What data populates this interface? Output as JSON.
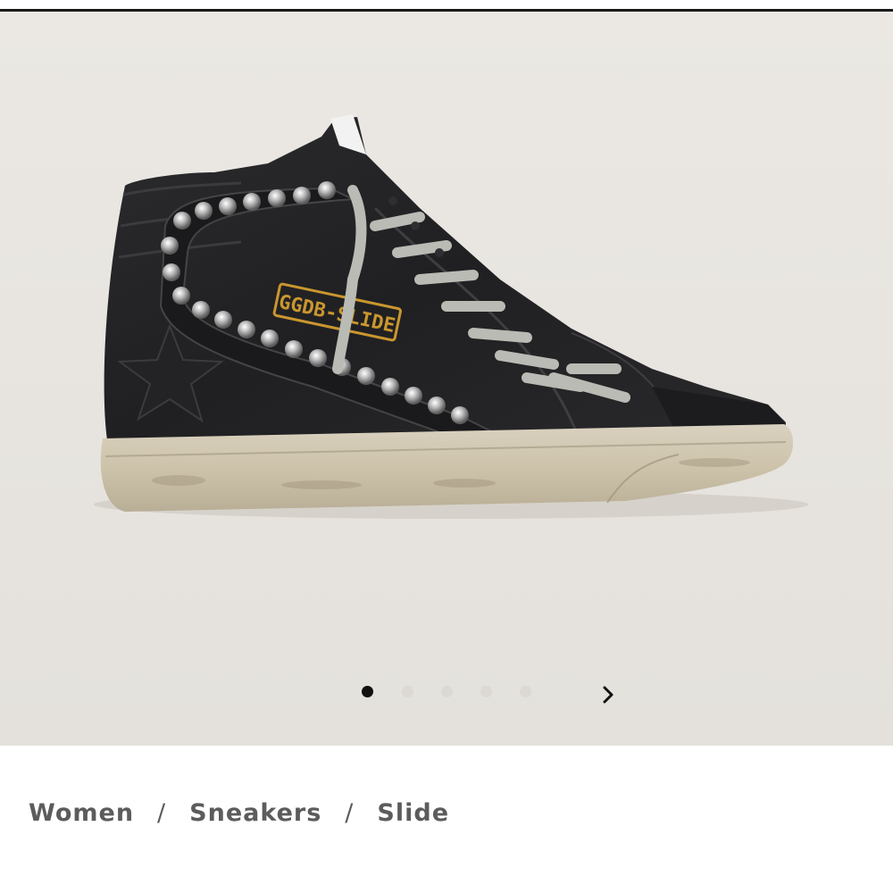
{
  "product": {
    "image_alt": "Slide sneaker in black leather with studs",
    "logo_text": "GGDB-SLIDE"
  },
  "carousel": {
    "dots": [
      {
        "active": true
      },
      {
        "active": false
      },
      {
        "active": false
      },
      {
        "active": false
      },
      {
        "active": false
      }
    ],
    "next_icon": "chevron-right-icon"
  },
  "breadcrumb": {
    "items": [
      "Women",
      "Sneakers",
      "Slide"
    ],
    "separator": "/"
  },
  "colors": {
    "background": "#e7e4df",
    "active_dot": "#111111",
    "inactive_dot": "#dcd9d4",
    "breadcrumb_text": "#5c5c5c"
  }
}
